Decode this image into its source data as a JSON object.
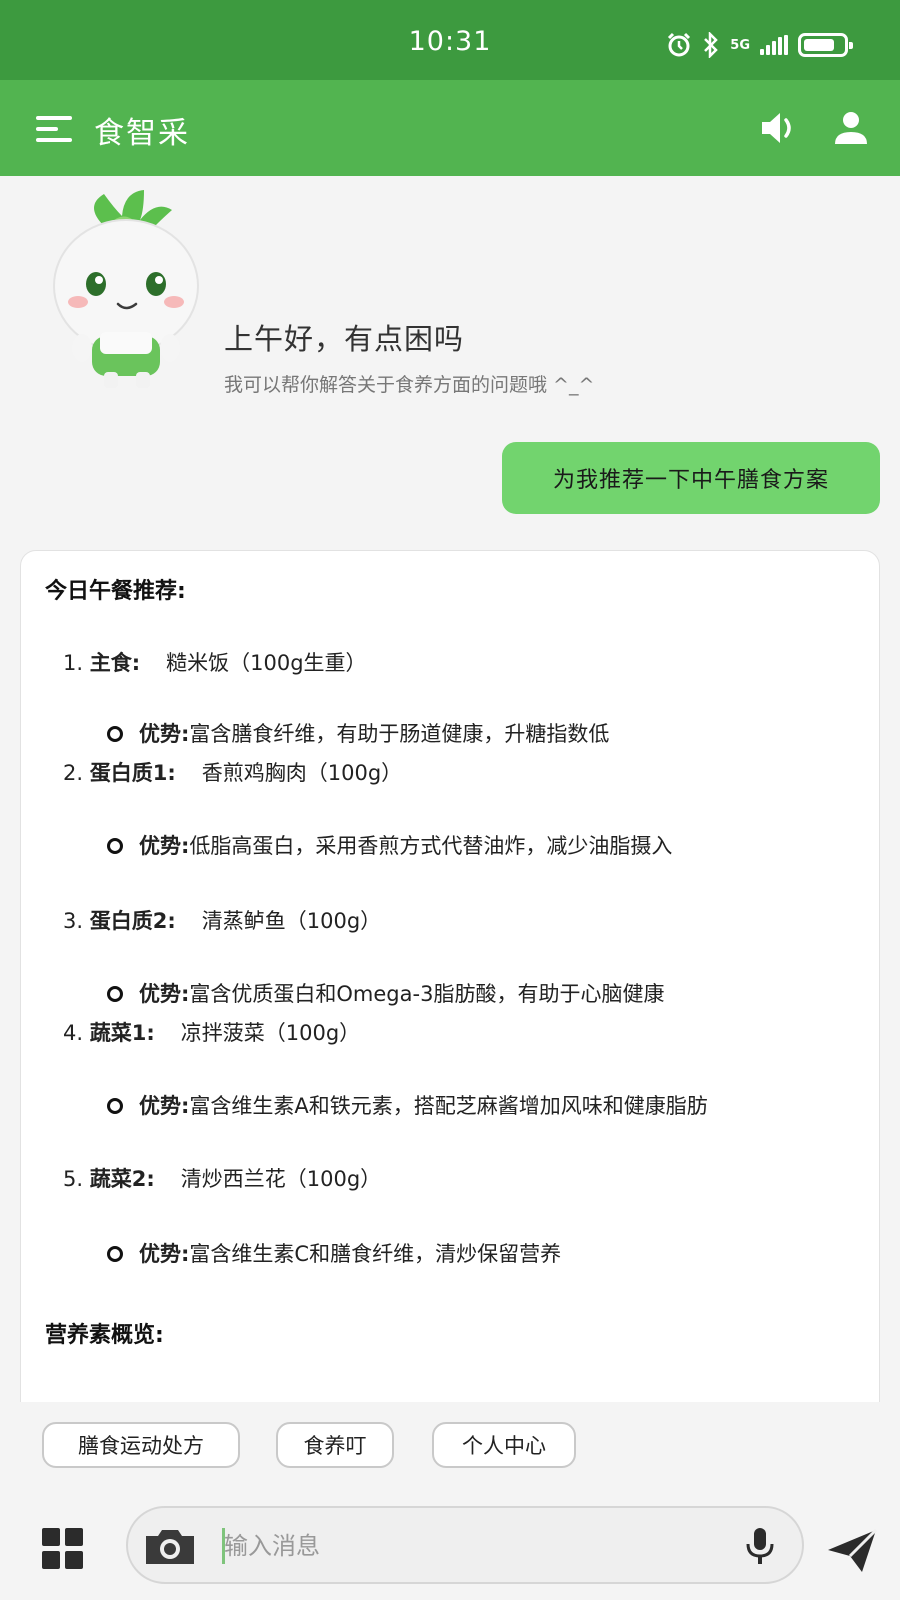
{
  "status_bar": {
    "time": "10:31",
    "network": "5G",
    "icons": [
      "alarm-icon",
      "bluetooth-icon",
      "signal-icon",
      "battery-icon"
    ],
    "battery_level": 0.8
  },
  "app_bar": {
    "title": "食智采",
    "icons": [
      "menu-icon",
      "volume-icon",
      "user-icon"
    ],
    "color": "#52b450"
  },
  "greeting": {
    "title": "上午好，有点困吗",
    "subtitle": "我可以帮你解答关于食养方面的问题哦 ^_^"
  },
  "user_message": "为我推荐一下中午膳食方案",
  "reply": {
    "heading": "今日午餐推荐:",
    "items": [
      {
        "num": "1.",
        "label": "主食:",
        "value": "糙米饭（100g生重）",
        "adv_label": "优势:",
        "adv_text": "富含膳食纤维，有助于肠道健康，升糖指数低"
      },
      {
        "num": "2.",
        "label": "蛋白质1:",
        "value": "香煎鸡胸肉（100g）",
        "adv_label": "优势:",
        "adv_text": "低脂高蛋白，采用香煎方式代替油炸，减少油脂摄入"
      },
      {
        "num": "3.",
        "label": "蛋白质2:",
        "value": "清蒸鲈鱼（100g）",
        "adv_label": "优势:",
        "adv_text": "富含优质蛋白和Omega-3脂肪酸，有助于心脑健康"
      },
      {
        "num": "4.",
        "label": "蔬菜1:",
        "value": "凉拌菠菜（100g）",
        "adv_label": "优势:",
        "adv_text": "富含维生素A和铁元素，搭配芝麻酱增加风味和健康脂肪"
      },
      {
        "num": "5.",
        "label": "蔬菜2:",
        "value": "清炒西兰花（100g）",
        "adv_label": "优势:",
        "adv_text": "富含维生素C和膳食纤维，清炒保留营养"
      }
    ],
    "section2": "营养素概览:"
  },
  "quick_chips": [
    "膳食运动处方",
    "食养叮",
    "个人中心"
  ],
  "input": {
    "placeholder": "输入消息",
    "icons": [
      "grid-icon",
      "camera-icon",
      "mic-icon",
      "send-icon"
    ]
  },
  "colors": {
    "status_bar": "#3d9a3f",
    "app_bar": "#52b450",
    "user_bubble": "#72d46e"
  }
}
